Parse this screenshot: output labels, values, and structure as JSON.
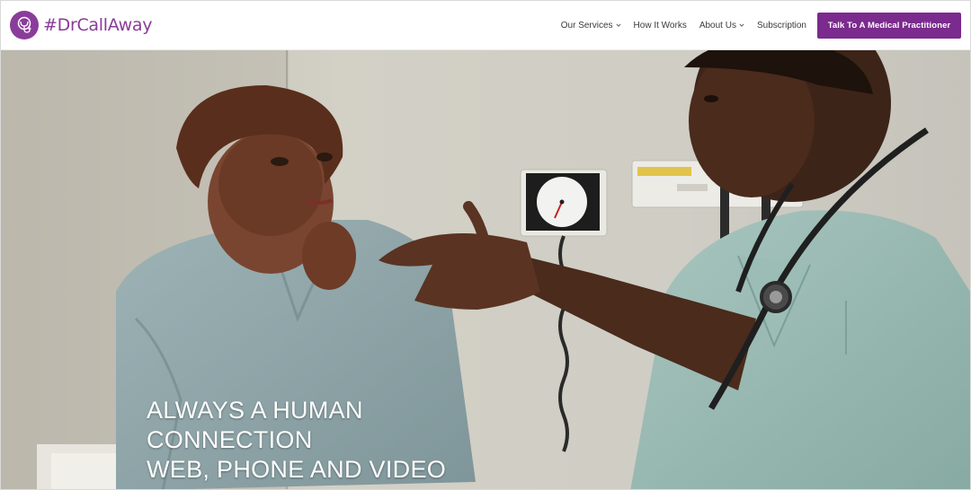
{
  "brand": {
    "name": "#DrCallAway",
    "logo_icon": "stethoscope-icon",
    "color": "#8a3c9a"
  },
  "nav": {
    "items": [
      {
        "label": "Our Services",
        "has_dropdown": true
      },
      {
        "label": "How It Works",
        "has_dropdown": false
      },
      {
        "label": "About Us",
        "has_dropdown": true
      },
      {
        "label": "Subscription",
        "has_dropdown": false
      }
    ]
  },
  "cta": {
    "label": "Talk To A Medical Practitioner",
    "color": "#7b2a8e"
  },
  "hero": {
    "lines": [
      "ALWAYS A HUMAN",
      "CONNECTION",
      "WEB, PHONE AND VIDEO"
    ],
    "image": "doctor-consulting-patient-photo"
  }
}
